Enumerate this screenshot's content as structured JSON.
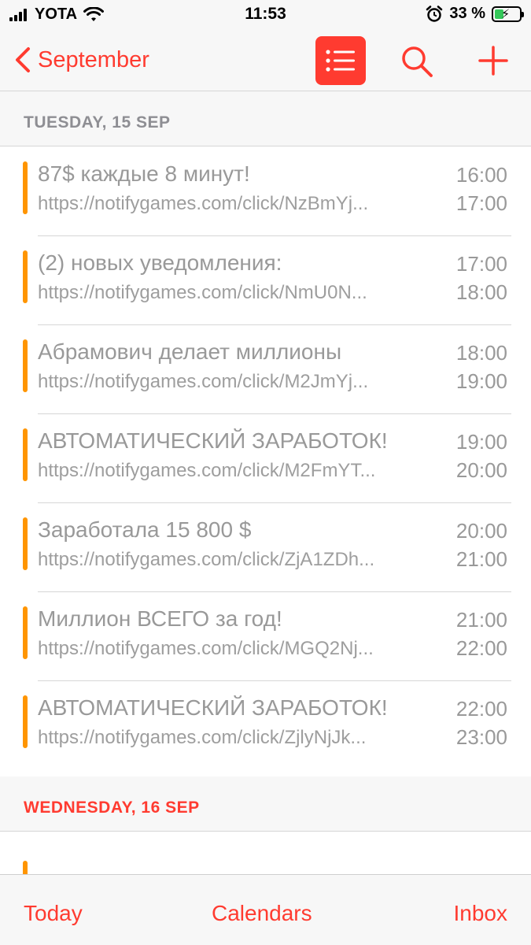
{
  "status_bar": {
    "carrier": "YOTA",
    "time": "11:53",
    "battery_percent": "33 %",
    "battery_level": 0.33,
    "icons": [
      "signal-icon",
      "wifi-icon",
      "alarm-icon",
      "battery-charging-icon"
    ]
  },
  "nav": {
    "back_label": "September",
    "list_button_icon": "list-icon",
    "search_icon": "search-icon",
    "add_icon": "plus-icon",
    "accent_color": "#ff3b30"
  },
  "days": [
    {
      "header": "TUESDAY, 15 SEP",
      "header_color": "#8e8e93",
      "events": [
        {
          "title": "87$ каждые 8 минут!",
          "url": "https://notifygames.com/click/NzBmYj...",
          "start": "16:00",
          "end": "17:00"
        },
        {
          "title": "(2) новых уведомления:",
          "url": "https://notifygames.com/click/NmU0N...",
          "start": "17:00",
          "end": "18:00"
        },
        {
          "title": "Абрамович делает миллионы",
          "url": "https://notifygames.com/click/M2JmYj...",
          "start": "18:00",
          "end": "19:00"
        },
        {
          "title": "АВТОМАТИЧЕСКИЙ ЗАРАБОТОК!",
          "url": "https://notifygames.com/click/M2FmYT...",
          "start": "19:00",
          "end": "20:00"
        },
        {
          "title": "Заработала 15 800 $",
          "url": "https://notifygames.com/click/ZjA1ZDh...",
          "start": "20:00",
          "end": "21:00"
        },
        {
          "title": "Миллион ВСЕГО за год!",
          "url": "https://notifygames.com/click/MGQ2Nj...",
          "start": "21:00",
          "end": "22:00"
        },
        {
          "title": "АВТОМАТИЧЕСКИЙ ЗАРАБОТОК!",
          "url": "https://notifygames.com/click/ZjlyNjJk...",
          "start": "22:00",
          "end": "23:00"
        }
      ]
    },
    {
      "header": "WEDNESDAY, 16 SEP",
      "header_color": "#ff3b30",
      "events": []
    }
  ],
  "event_bar_color": "#ff9500",
  "tabs": {
    "today": "Today",
    "calendars": "Calendars",
    "inbox": "Inbox"
  }
}
